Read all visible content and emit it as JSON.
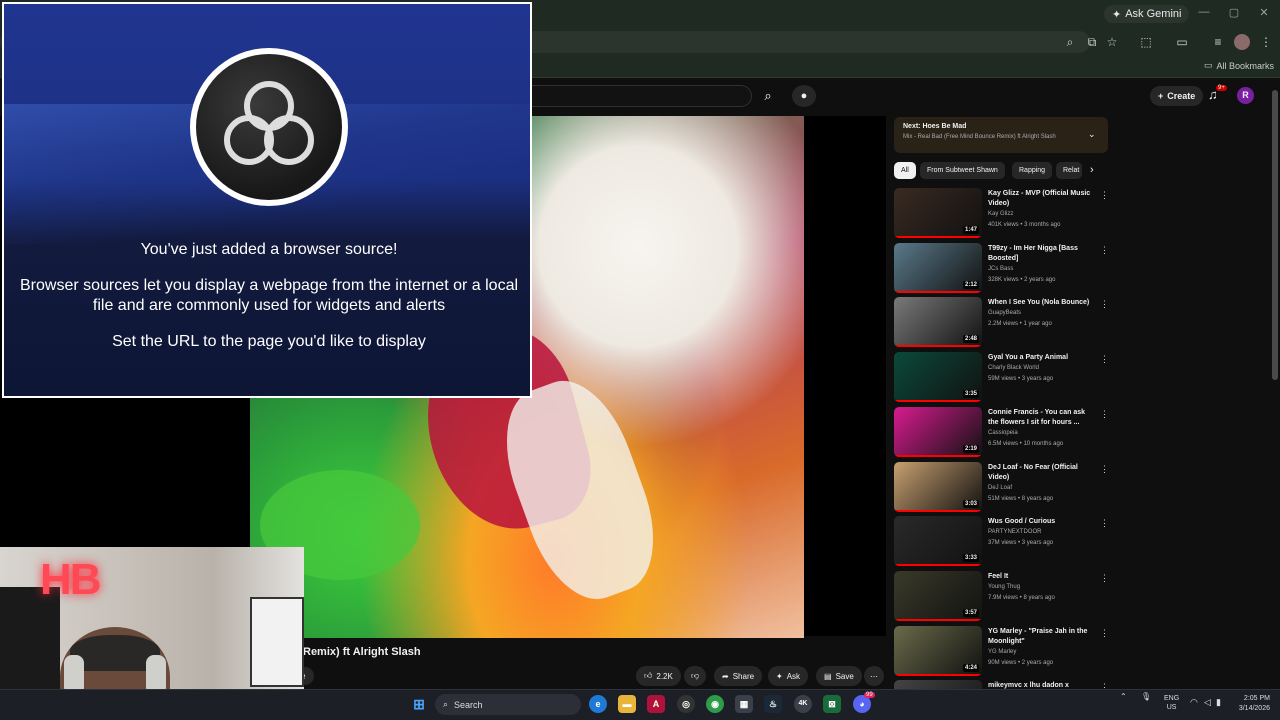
{
  "browser": {
    "ask_gemini": "Ask Gemini",
    "all_bookmarks": "All Bookmarks",
    "window_controls": [
      "—",
      "▢",
      "✕"
    ]
  },
  "youtube": {
    "create_label": "Create",
    "notif_count": "9+",
    "avatar_letter": "R",
    "video_title": "Remix) ft Alright Slash",
    "actions": {
      "likes": "2.2K",
      "share": "Share",
      "ask": "Ask",
      "save": "Save"
    },
    "next": {
      "title": "Next: Hoes Be Mad",
      "subtitle": "Mix - Real Bad (Free Mind Bounce Remix) ft Alright Slash"
    },
    "chips": [
      "All",
      "From Subtweet Shawn",
      "Rapping",
      "Relat"
    ],
    "recommendations": [
      {
        "title": "Kay Glizz - MVP (Official Music Video)",
        "channel": "Kay Glizz",
        "meta": "401K views • 3 months ago",
        "duration": "1:47",
        "thumb": "#3a2a22"
      },
      {
        "title": "T99zy - Im Her Nigga [Bass Boosted]",
        "channel": "JCs Bass",
        "meta": "328K views • 2 years ago",
        "duration": "2:12",
        "thumb": "#5a7a8a"
      },
      {
        "title": "When I See You (Nola Bounce)",
        "channel": "GuapyBeats",
        "meta": "2.2M views • 1 year ago",
        "duration": "2:48",
        "thumb": "#7a7a7a"
      },
      {
        "title": "Gyal You a Party Animal",
        "channel": "Charly Black World",
        "meta": "59M views • 3 years ago",
        "duration": "3:35",
        "thumb": "#0a4a3a"
      },
      {
        "title": "Connie Francis - You can ask the flowers I sit for hours ...",
        "channel": "Cassiopeia",
        "meta": "6.5M views • 10 months ago",
        "duration": "2:19",
        "thumb": "#d81b90"
      },
      {
        "title": "DeJ Loaf - No Fear (Official Video)",
        "channel": "DeJ Loaf",
        "meta": "51M views • 8 years ago",
        "duration": "3:03",
        "thumb": "#c8a070"
      },
      {
        "title": "Wus Good / Curious",
        "channel": "PARTYNEXTDOOR",
        "meta": "37M views • 3 years ago",
        "duration": "3:33",
        "thumb": "#2a2a2a"
      },
      {
        "title": "Feel It",
        "channel": "Young Thug",
        "meta": "7.9M views • 8 years ago",
        "duration": "3:57",
        "thumb": "#3a3a2a"
      },
      {
        "title": "YG Marley - \"Praise Jah in the Moonlight\"",
        "channel": "YG Marley",
        "meta": "90M views • 2 years ago",
        "duration": "4:24",
        "thumb": "#6a6a4a"
      },
      {
        "title": "mikeymvc x lhu dadon x",
        "channel": "",
        "meta": "",
        "duration": "",
        "thumb": "#444444"
      }
    ]
  },
  "obs": {
    "line1": "You've just added a browser source!",
    "line2a": "Browser sources let you display a webpage from the internet or a local",
    "line2b": "file and are commonly used for widgets and alerts",
    "line3": "Set the URL to the page you'd like to display"
  },
  "webcam": {
    "sign": "HB"
  },
  "taskbar": {
    "search": "Search",
    "lang_top": "ENG",
    "lang_bottom": "US",
    "time": "2:05 PM",
    "date": "3/14/2026",
    "discord_badge": "99"
  }
}
